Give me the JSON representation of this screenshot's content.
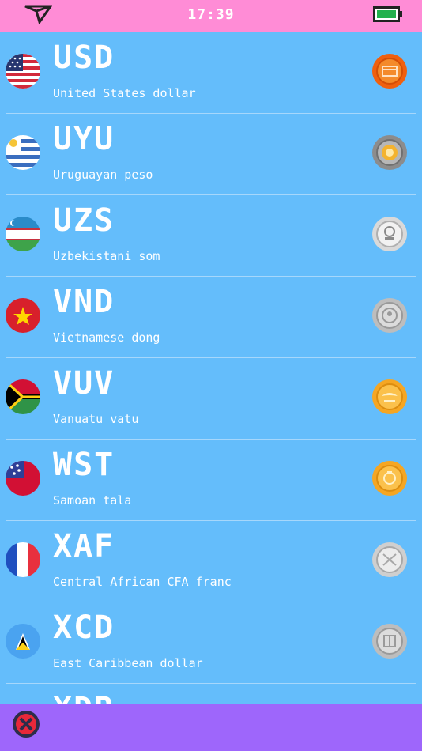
{
  "status_bar": {
    "time": "17:39"
  },
  "currencies": [
    {
      "code": "USD",
      "name": "United States dollar",
      "coin": "orange-coin-icon"
    },
    {
      "code": "UYU",
      "name": "Uruguayan peso",
      "coin": "gray-gold-coin-icon"
    },
    {
      "code": "UZS",
      "name": "Uzbekistani som",
      "coin": "white-coin-icon"
    },
    {
      "code": "VND",
      "name": "Vietnamese dong",
      "coin": "silver-coin-icon"
    },
    {
      "code": "VUV",
      "name": "Vanuatu vatu",
      "coin": "gold-coin-icon"
    },
    {
      "code": "WST",
      "name": "Samoan tala",
      "coin": "gold-coin-icon"
    },
    {
      "code": "XAF",
      "name": "Central African CFA franc",
      "coin": "silver-coin-icon"
    },
    {
      "code": "XCD",
      "name": "East Caribbean dollar",
      "coin": "silver-coin-icon"
    },
    {
      "code": "XDR",
      "name": "",
      "coin": ""
    }
  ],
  "colors": {
    "status_bar": "#ff8cd6",
    "list_background": "#64bdfb",
    "bottom_bar": "#9e66fb",
    "close_button": "#e8283a"
  }
}
